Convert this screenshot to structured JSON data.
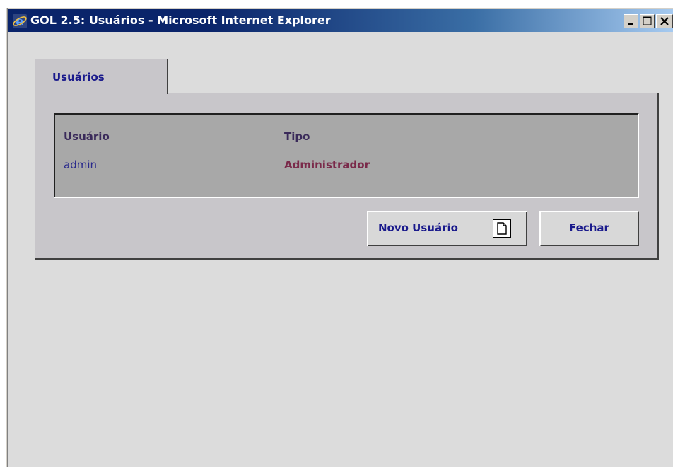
{
  "window": {
    "title": "GOL 2.5: Usuários - Microsoft Internet Explorer",
    "controls": [
      "minimize",
      "maximize",
      "close"
    ]
  },
  "tabs": [
    {
      "label": "Usuários",
      "active": true
    }
  ],
  "table": {
    "columns": [
      "Usuário",
      "Tipo"
    ],
    "rows": [
      {
        "usuario": "admin",
        "tipo": "Administrador"
      }
    ]
  },
  "buttons": {
    "novo_usuario": "Novo Usuário",
    "fechar": "Fechar"
  },
  "icons": {
    "app": "ie-icon",
    "novo_usuario": "new-document-icon"
  },
  "colors": {
    "titlebar_start": "#0a246a",
    "titlebar_end": "#a6caf0",
    "label_blue": "#1a1a8c",
    "type_text": "#7a2a4a",
    "grid_bg": "#a8a8a8"
  }
}
